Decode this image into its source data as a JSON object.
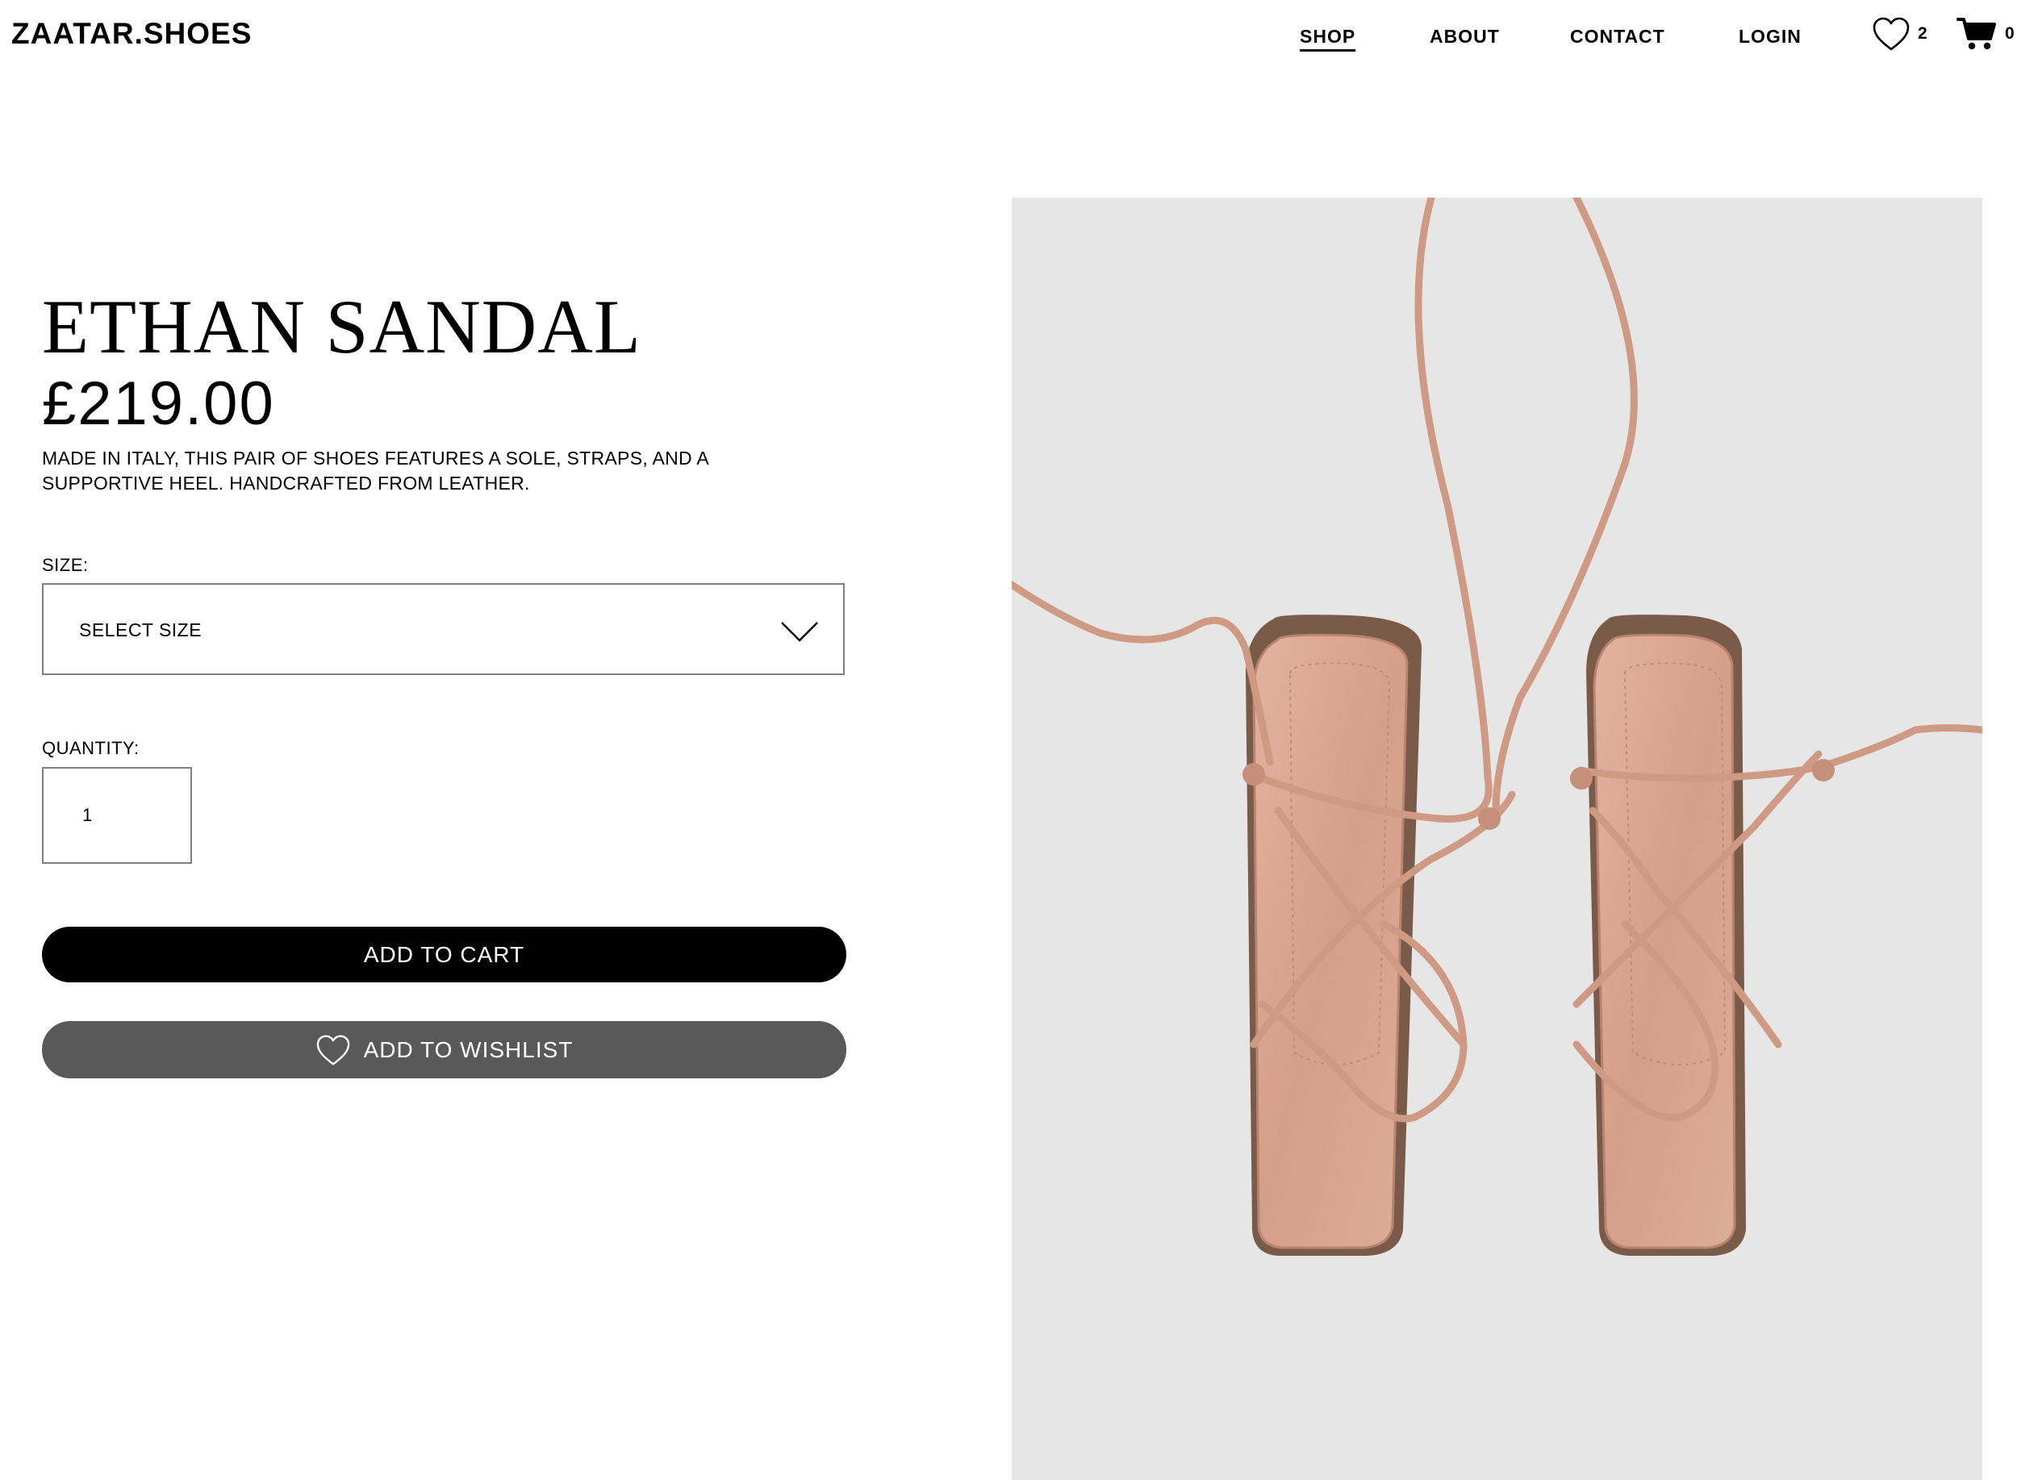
{
  "brand": {
    "logo": "ZAATAR.SHOES"
  },
  "nav": {
    "links": [
      {
        "label": "SHOP",
        "active": true
      },
      {
        "label": "ABOUT",
        "active": false
      },
      {
        "label": "CONTACT",
        "active": false
      },
      {
        "label": "LOGIN",
        "active": false
      }
    ],
    "wishlist": {
      "icon": "heart-icon",
      "count": "2"
    },
    "cart": {
      "icon": "cart-icon",
      "count": "0"
    }
  },
  "product": {
    "title": "ETHAN SANDAL",
    "price": "£219.00",
    "description": "MADE IN ITALY, THIS PAIR OF SHOES FEATURES A SOLE, STRAPS, AND A SUPPORTIVE HEEL. HANDCRAFTED FROM LEATHER.",
    "size": {
      "label": "SIZE:",
      "selected": "SELECT SIZE",
      "icon": "chevron-down-icon"
    },
    "quantity": {
      "label": "QUANTITY:",
      "value": "1"
    },
    "add_to_cart": "ADD TO CART",
    "add_to_wishlist": {
      "label": "ADD TO WISHLIST",
      "icon": "heart-icon"
    },
    "image": {
      "subject": "pair of nude leather strappy sandals, top view",
      "background": "#e6e6e6",
      "leather": "#d8a58e"
    }
  },
  "colors": {
    "text": "#000000",
    "primary_button": "#000000",
    "secondary_button": "#595959",
    "border": "#808080"
  }
}
